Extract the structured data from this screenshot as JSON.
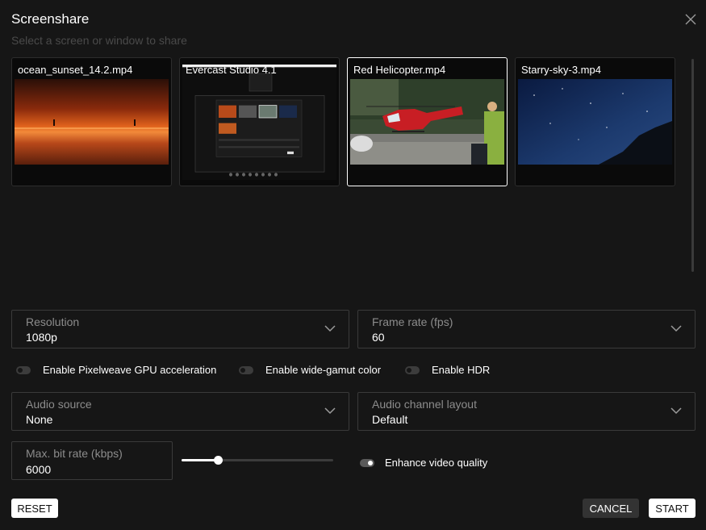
{
  "dialog": {
    "title": "Screenshare",
    "subtitle": "Select a screen or window to share"
  },
  "sources": [
    {
      "label": "ocean_sunset_14.2.mp4",
      "selected": false
    },
    {
      "label": "Evercast Studio 4.1",
      "selected": false
    },
    {
      "label": "Red Helicopter.mp4",
      "selected": true
    },
    {
      "label": "Starry-sky-3.mp4",
      "selected": false
    }
  ],
  "resolution": {
    "label": "Resolution",
    "value": "1080p"
  },
  "frame_rate": {
    "label": "Frame rate (fps)",
    "value": "60"
  },
  "toggles": {
    "gpu": {
      "label": "Enable Pixelweave GPU acceleration",
      "on": false
    },
    "wide_gamut": {
      "label": "Enable wide-gamut color",
      "on": false
    },
    "hdr": {
      "label": "Enable HDR",
      "on": false
    },
    "enhance": {
      "label": "Enhance video quality",
      "on": true
    }
  },
  "audio_source": {
    "label": "Audio source",
    "value": "None"
  },
  "audio_layout": {
    "label": "Audio channel layout",
    "value": "Default"
  },
  "bitrate": {
    "label": "Max. bit rate (kbps)",
    "value": "6000",
    "slider_fraction": 0.17
  },
  "buttons": {
    "reset": "RESET",
    "cancel": "CANCEL",
    "start": "START"
  },
  "colors": {
    "background": "#161616",
    "border": "#3a3a3a",
    "muted_text": "#8c8c8c",
    "accent": "#ffffff"
  }
}
